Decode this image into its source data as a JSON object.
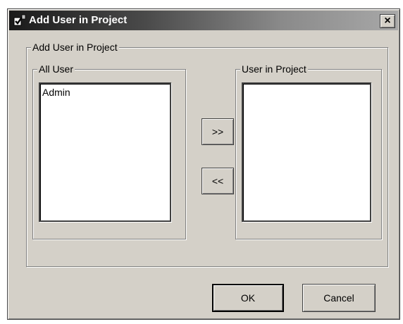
{
  "window": {
    "title": "Add User in Project",
    "close_label": "×"
  },
  "outer_group": {
    "title": "Add User in Project"
  },
  "all_users": {
    "title": "All User",
    "items": [
      "Admin"
    ]
  },
  "project_users": {
    "title": "User in Project",
    "items": []
  },
  "buttons": {
    "add_label": ">>",
    "remove_label": "<<",
    "ok_label": "OK",
    "cancel_label": "Cancel"
  },
  "icons": {
    "app": "app-icon",
    "close": "close-icon"
  }
}
